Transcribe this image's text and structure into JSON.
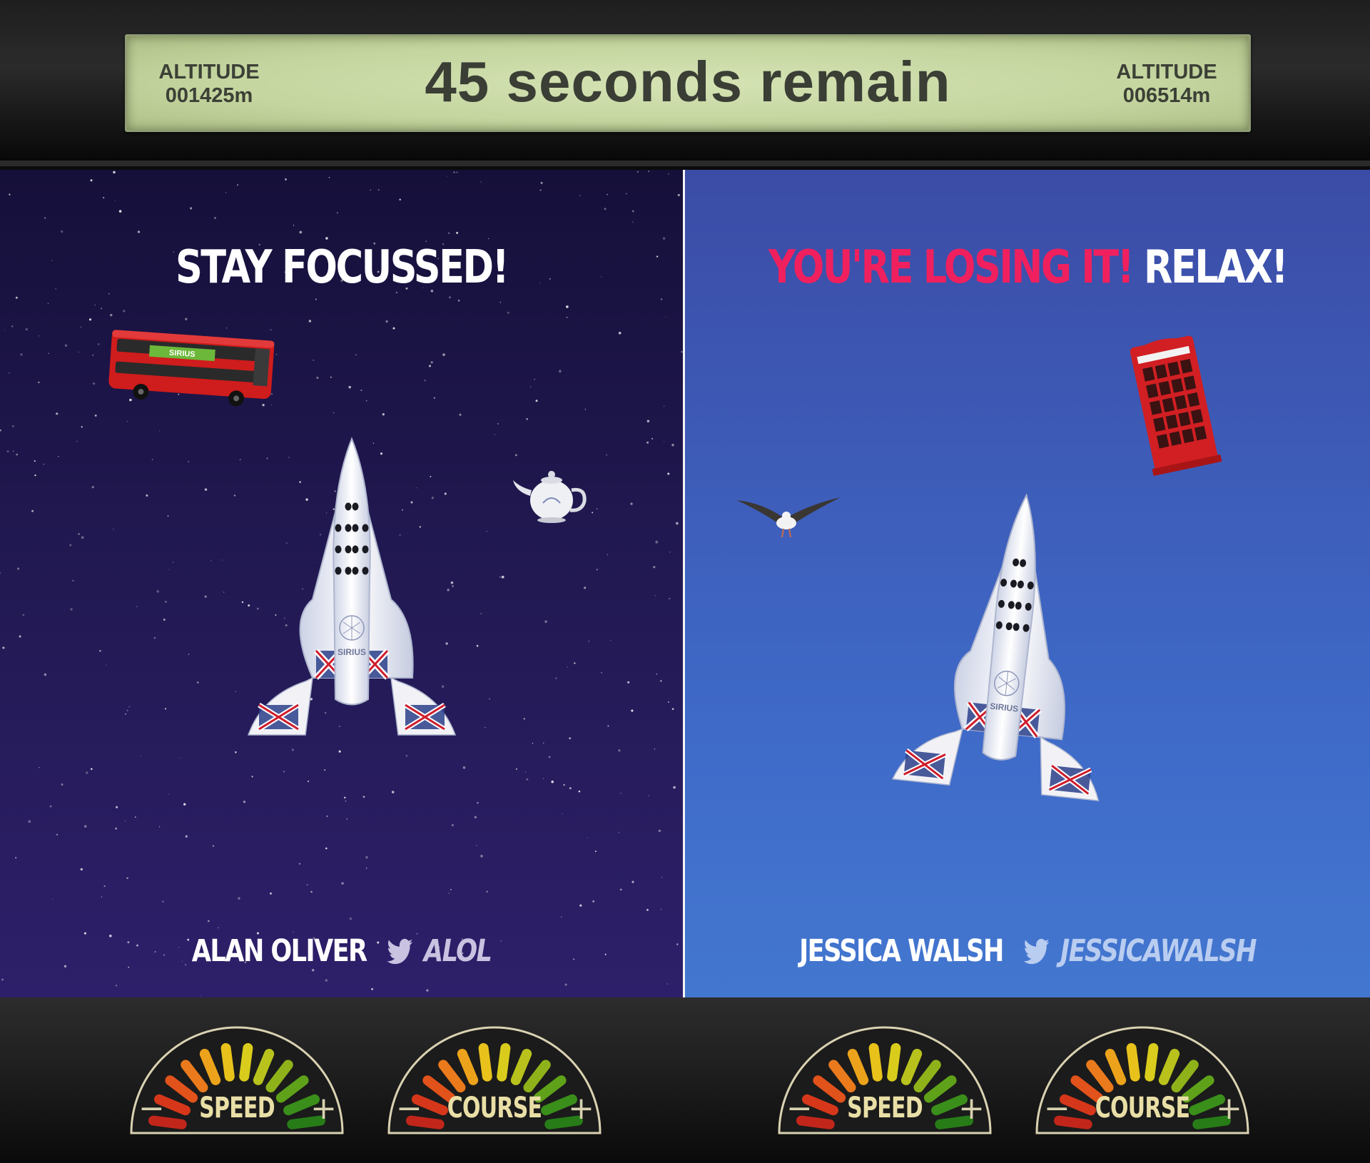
{
  "top_bar": {
    "left_altitude_label": "ALTITUDE",
    "left_altitude_value": "001425m",
    "timer_text": "45 seconds remain",
    "right_altitude_label": "ALTITUDE",
    "right_altitude_value": "006514m"
  },
  "left_player": {
    "headline": "STAY FOCUSSED!",
    "name": "ALAN OLIVER",
    "handle": "ALOL",
    "ship_logo": "SIRIUS",
    "bus_banner": "SIRIUS",
    "background_color": "#231a55"
  },
  "right_player": {
    "headline_warning": "YOU'RE LOSING IT!",
    "headline_instruction": "RELAX!",
    "name": "JESSICA WALSH",
    "handle": "JESSICAWALSH",
    "ship_logo": "SIRIUS",
    "background_color": "#3f6bc9",
    "warning_color": "#f0205e"
  },
  "gauges": [
    {
      "label": "SPEED",
      "minus": "−",
      "plus": "+"
    },
    {
      "label": "COURSE",
      "minus": "−",
      "plus": "+"
    },
    {
      "label": "SPEED",
      "minus": "−",
      "plus": "+"
    },
    {
      "label": "COURSE",
      "minus": "−",
      "plus": "+"
    }
  ]
}
